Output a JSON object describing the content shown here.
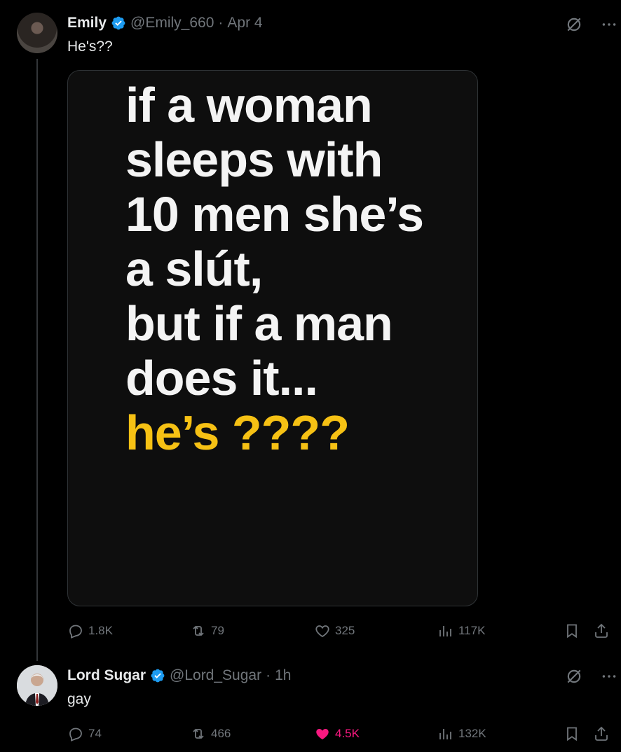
{
  "tweets": [
    {
      "name": "Emily",
      "handle": "@Emily_660",
      "separator": "·",
      "time": "Apr 4",
      "text": "He's??",
      "media": {
        "lines": [
          "if a woman",
          "sleeps with",
          "10 men she’s",
          "a slút,",
          "but if a man",
          "does it..."
        ],
        "highlight": "he’s ????",
        "highlight_color": "#f6c114"
      },
      "stats": {
        "replies": "1.8K",
        "reposts": "79",
        "likes": "325",
        "views": "117K"
      }
    },
    {
      "name": "Lord Sugar",
      "handle": "@Lord_Sugar",
      "separator": "·",
      "time": "1h",
      "text": "gay",
      "stats": {
        "replies": "74",
        "reposts": "466",
        "likes": "4.5K",
        "views": "132K"
      },
      "liked": true
    }
  ],
  "colors": {
    "background": "#000000",
    "verified": "#1d9bf0",
    "muted": "#71767b",
    "like_active": "#f91880"
  },
  "icons": [
    "grok-icon",
    "more-icon",
    "reply-icon",
    "repost-icon",
    "like-icon",
    "views-icon",
    "bookmark-icon",
    "share-icon"
  ]
}
